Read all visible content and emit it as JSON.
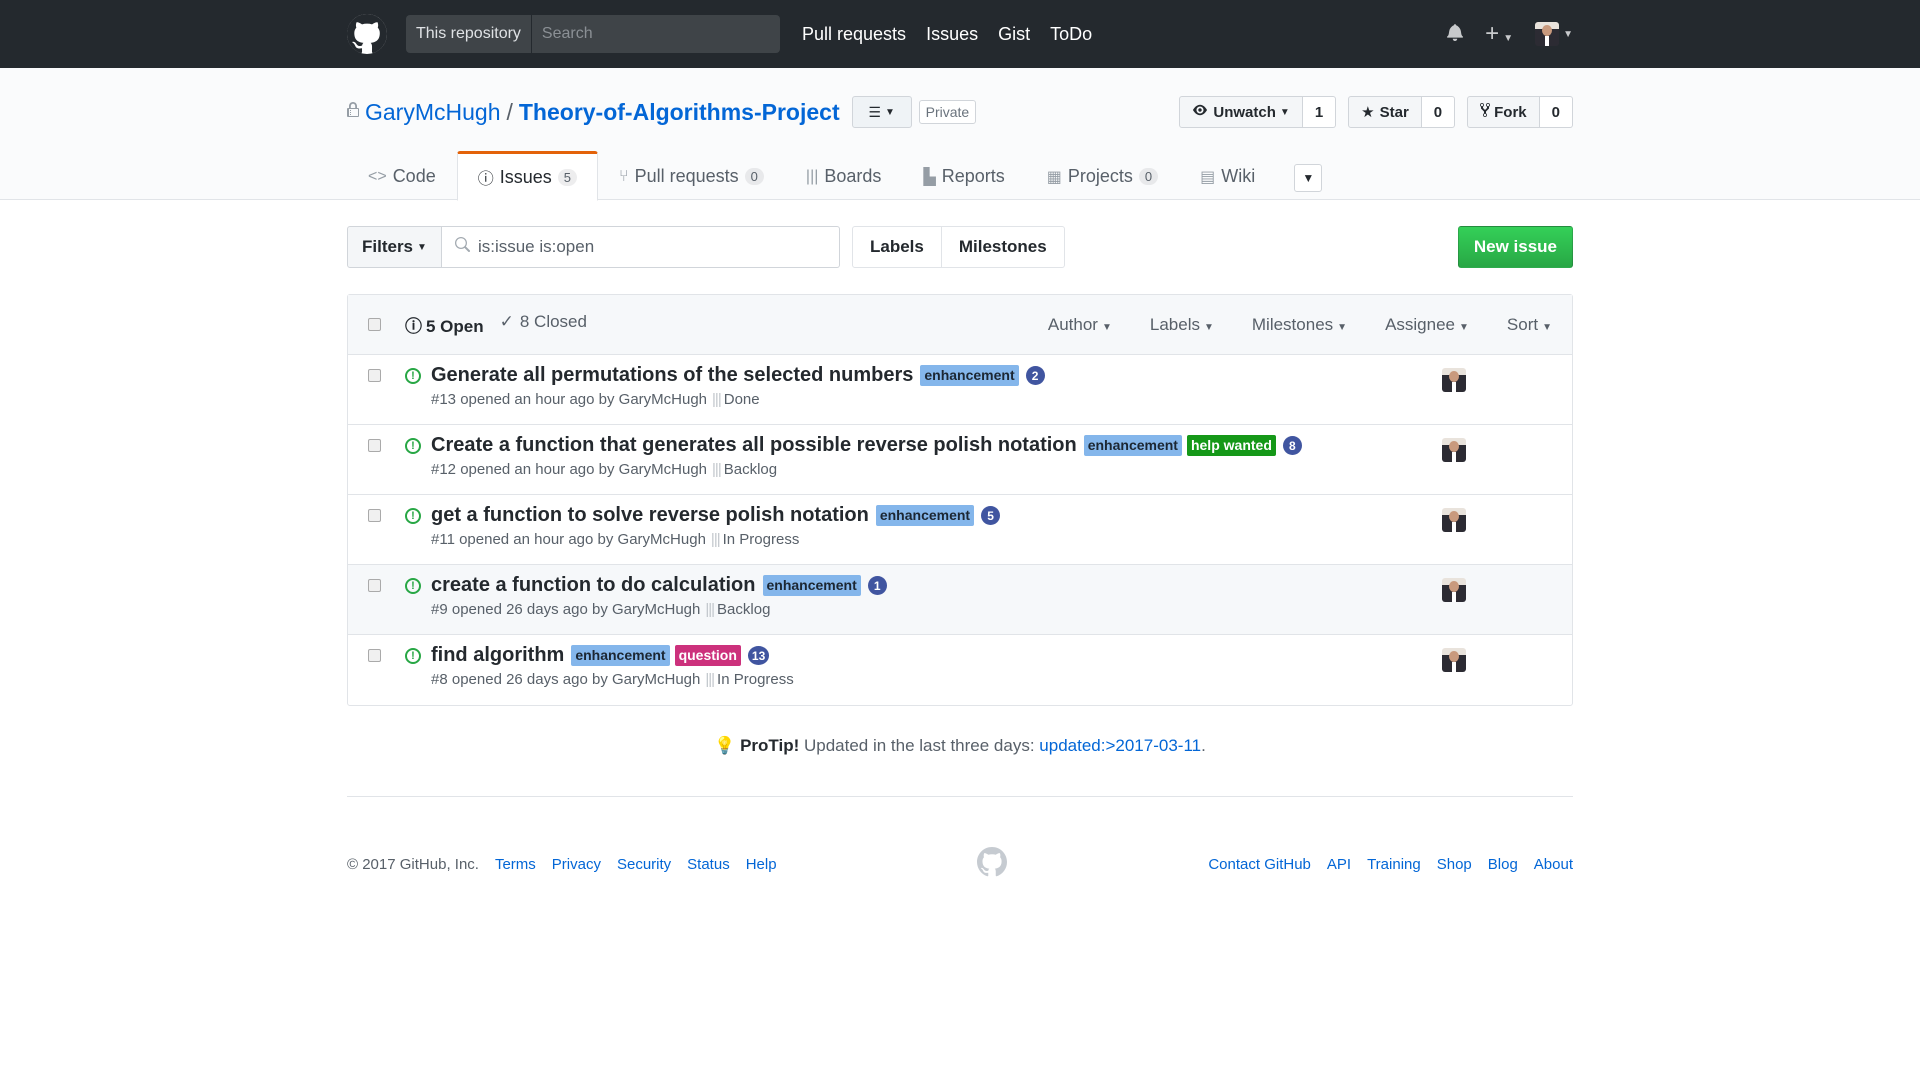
{
  "header": {
    "scope": "This repository",
    "search_placeholder": "Search",
    "nav": [
      "Pull requests",
      "Issues",
      "Gist",
      "ToDo"
    ]
  },
  "repo": {
    "owner": "GaryMcHugh",
    "name": "Theory-of-Algorithms-Project",
    "private_label": "Private",
    "watch_label": "Unwatch",
    "watch_count": "1",
    "star_label": "Star",
    "star_count": "0",
    "fork_label": "Fork",
    "fork_count": "0"
  },
  "tabs": [
    {
      "label": "Code",
      "count": null
    },
    {
      "label": "Issues",
      "count": "5"
    },
    {
      "label": "Pull requests",
      "count": "0"
    },
    {
      "label": "Boards",
      "count": null
    },
    {
      "label": "Reports",
      "count": null
    },
    {
      "label": "Projects",
      "count": "0"
    },
    {
      "label": "Wiki",
      "count": null
    }
  ],
  "subnav": {
    "filters_label": "Filters",
    "query_value": "is:issue is:open",
    "labels": "Labels",
    "milestones": "Milestones",
    "new_issue": "New issue"
  },
  "list_header": {
    "open": "5 Open",
    "closed": "8 Closed",
    "author": "Author",
    "labels": "Labels",
    "milestones": "Milestones",
    "assignee": "Assignee",
    "sort": "Sort"
  },
  "issues": [
    {
      "title": "Generate all permutations of the selected numbers",
      "labels": [
        "enhancement"
      ],
      "estimate": "2",
      "meta": "#13 opened an hour ago by GaryMcHugh",
      "pipeline": "Done"
    },
    {
      "title": "Create a function that generates all possible reverse polish notation",
      "labels": [
        "enhancement",
        "help wanted"
      ],
      "estimate": "8",
      "meta": "#12 opened an hour ago by GaryMcHugh",
      "pipeline": "Backlog"
    },
    {
      "title": "get a function to solve reverse polish notation",
      "labels": [
        "enhancement"
      ],
      "estimate": "5",
      "meta": "#11 opened an hour ago by GaryMcHugh",
      "pipeline": "In Progress"
    },
    {
      "title": "create a function to do calculation",
      "labels": [
        "enhancement"
      ],
      "estimate": "1",
      "meta": "#9 opened 26 days ago by GaryMcHugh",
      "pipeline": "Backlog"
    },
    {
      "title": "find algorithm",
      "labels": [
        "enhancement",
        "question"
      ],
      "estimate": "13",
      "meta": "#8 opened 26 days ago by GaryMcHugh",
      "pipeline": "In Progress"
    }
  ],
  "protip": {
    "strong": "ProTip!",
    "text": " Updated in the last three days: ",
    "link": "updated:>2017-03-11",
    "end": "."
  },
  "footer": {
    "copyright": "© 2017 GitHub, Inc.",
    "left_links": [
      "Terms",
      "Privacy",
      "Security",
      "Status",
      "Help"
    ],
    "right_links": [
      "Contact GitHub",
      "API",
      "Training",
      "Shop",
      "Blog",
      "About"
    ]
  },
  "colors": {
    "header_bg": "#24292e",
    "link": "#0366d6",
    "open_green": "#28a745",
    "enhancement": "#84b6eb",
    "help_wanted": "#159818",
    "question": "#cc317c",
    "estimate": "#4055a0",
    "selected_tab_accent": "#e36209"
  }
}
